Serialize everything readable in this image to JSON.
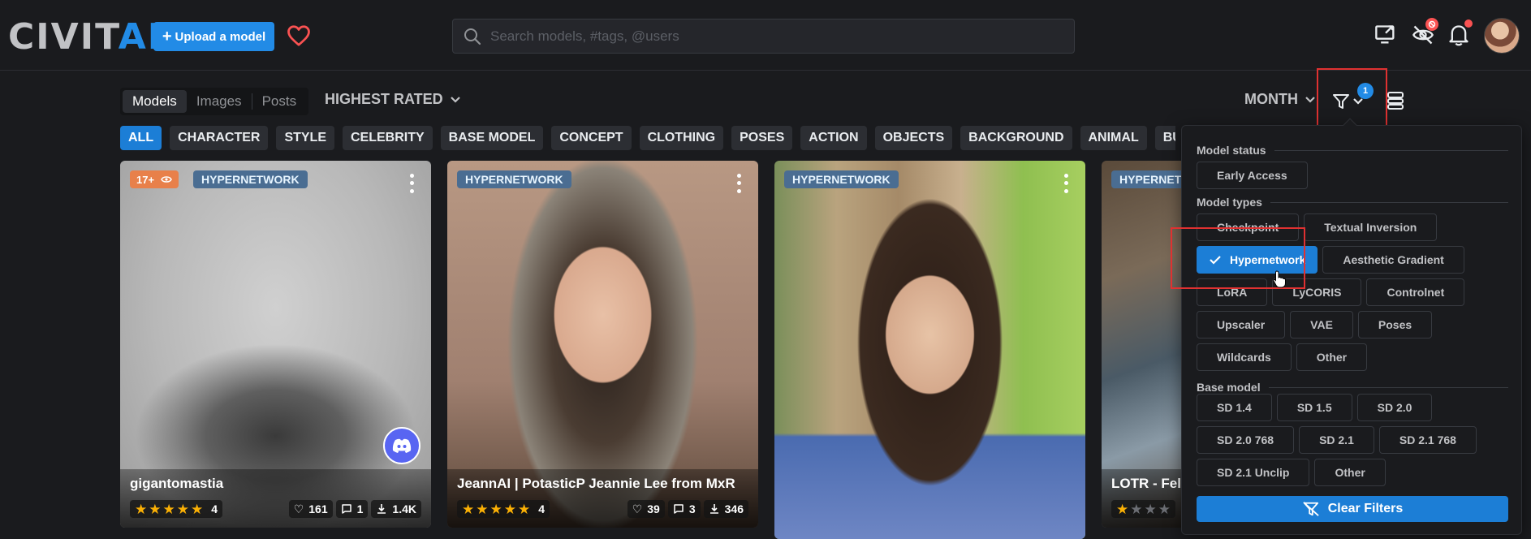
{
  "header": {
    "logo_part1": "CIVIT",
    "logo_part2": "AI",
    "upload_label": "Upload a model",
    "search_placeholder": "Search models, #tags, @users"
  },
  "toolbar": {
    "segments": [
      "Models",
      "Images",
      "Posts"
    ],
    "active_segment": "Models",
    "sort_label": "HIGHEST RATED",
    "period_label": "MONTH",
    "filter_count": "1"
  },
  "tags": [
    "ALL",
    "CHARACTER",
    "STYLE",
    "CELEBRITY",
    "BASE MODEL",
    "CONCEPT",
    "CLOTHING",
    "POSES",
    "ACTION",
    "OBJECTS",
    "BACKGROUND",
    "ANIMAL",
    "BUILDINGS"
  ],
  "active_tag": "ALL",
  "cards": [
    {
      "nsfw_label": "17+",
      "type_badge": "HYPERNETWORK",
      "title": "gigantomastia",
      "rating_count": "4",
      "stars_filled": 5,
      "likes": "161",
      "comments": "1",
      "downloads": "1.4K"
    },
    {
      "type_badge": "HYPERNETWORK",
      "title": "JeannAI | PotasticP Jeannie Lee from MxR",
      "rating_count": "4",
      "stars_filled": 5,
      "likes": "39",
      "comments": "3",
      "downloads": "346"
    },
    {
      "type_badge": "HYPERNETWORK"
    },
    {
      "type_badge": "HYPERNETWORK",
      "title": "LOTR - Fello",
      "stars_filled": 1
    }
  ],
  "filter_panel": {
    "model_status_heading": "Model status",
    "model_status": [
      "Early Access"
    ],
    "model_types_heading": "Model types",
    "model_types": [
      "Checkpoint",
      "Textual Inversion",
      "Hypernetwork",
      "Aesthetic Gradient",
      "LoRA",
      "LyCORIS",
      "Controlnet",
      "Upscaler",
      "VAE",
      "Poses",
      "Wildcards",
      "Other"
    ],
    "selected_model_type": "Hypernetwork",
    "base_model_heading": "Base model",
    "base_models": [
      "SD 1.4",
      "SD 1.5",
      "SD 2.0",
      "SD 2.0 768",
      "SD 2.1",
      "SD 2.1 768",
      "SD 2.1 Unclip",
      "Other"
    ],
    "clear_label": "Clear Filters"
  },
  "colors": {
    "accent": "#228be6",
    "highlight_box": "#e03131",
    "star": "#fab005",
    "background": "#1a1b1e"
  }
}
